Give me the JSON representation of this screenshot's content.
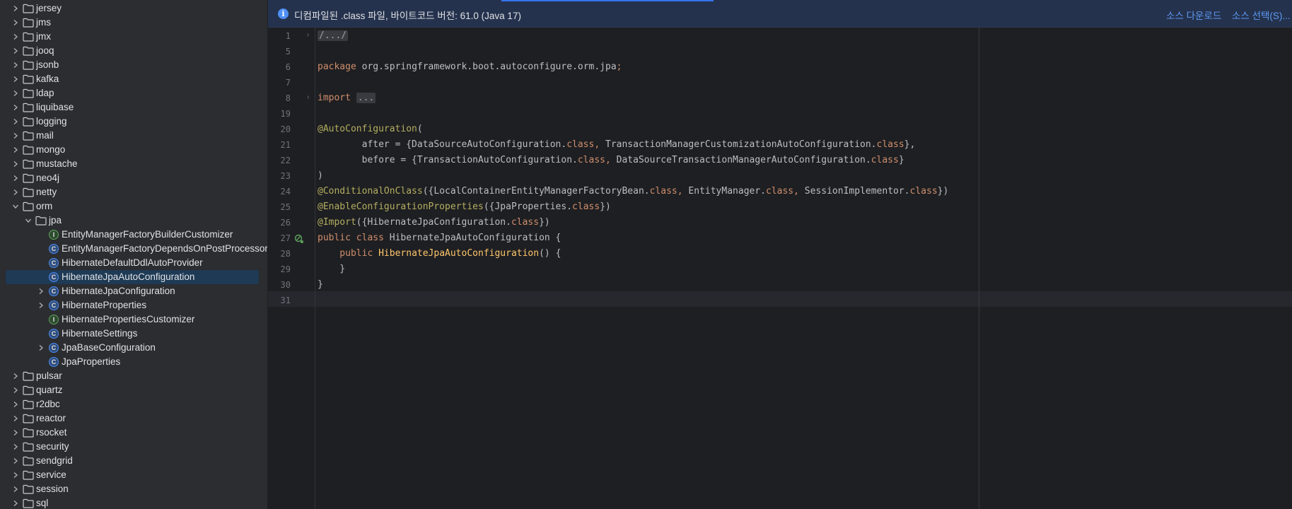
{
  "sidebar": {
    "items": [
      {
        "label": "jersey",
        "type": "folder",
        "expanded": false
      },
      {
        "label": "jms",
        "type": "folder",
        "expanded": false
      },
      {
        "label": "jmx",
        "type": "folder",
        "expanded": false
      },
      {
        "label": "jooq",
        "type": "folder",
        "expanded": false
      },
      {
        "label": "jsonb",
        "type": "folder",
        "expanded": false
      },
      {
        "label": "kafka",
        "type": "folder",
        "expanded": false
      },
      {
        "label": "ldap",
        "type": "folder",
        "expanded": false
      },
      {
        "label": "liquibase",
        "type": "folder",
        "expanded": false
      },
      {
        "label": "logging",
        "type": "folder",
        "expanded": false
      },
      {
        "label": "mail",
        "type": "folder",
        "expanded": false
      },
      {
        "label": "mongo",
        "type": "folder",
        "expanded": false
      },
      {
        "label": "mustache",
        "type": "folder",
        "expanded": false
      },
      {
        "label": "neo4j",
        "type": "folder",
        "expanded": false
      },
      {
        "label": "netty",
        "type": "folder",
        "expanded": false
      },
      {
        "label": "orm",
        "type": "folder",
        "expanded": true
      },
      {
        "label": "jpa",
        "type": "folder",
        "expanded": true
      },
      {
        "label": "EntityManagerFactoryBuilderCustomizer",
        "type": "interface"
      },
      {
        "label": "EntityManagerFactoryDependsOnPostProcessor",
        "type": "class"
      },
      {
        "label": "HibernateDefaultDdlAutoProvider",
        "type": "class"
      },
      {
        "label": "HibernateJpaAutoConfiguration",
        "type": "class",
        "selected": true
      },
      {
        "label": "HibernateJpaConfiguration",
        "type": "class",
        "expandable": true
      },
      {
        "label": "HibernateProperties",
        "type": "class",
        "expandable": true
      },
      {
        "label": "HibernatePropertiesCustomizer",
        "type": "interface"
      },
      {
        "label": "HibernateSettings",
        "type": "class"
      },
      {
        "label": "JpaBaseConfiguration",
        "type": "class",
        "expandable": true
      },
      {
        "label": "JpaProperties",
        "type": "class"
      },
      {
        "label": "pulsar",
        "type": "folder",
        "expanded": false
      },
      {
        "label": "quartz",
        "type": "folder",
        "expanded": false
      },
      {
        "label": "r2dbc",
        "type": "folder",
        "expanded": false
      },
      {
        "label": "reactor",
        "type": "folder",
        "expanded": false
      },
      {
        "label": "rsocket",
        "type": "folder",
        "expanded": false
      },
      {
        "label": "security",
        "type": "folder",
        "expanded": false
      },
      {
        "label": "sendgrid",
        "type": "folder",
        "expanded": false
      },
      {
        "label": "service",
        "type": "folder",
        "expanded": false
      },
      {
        "label": "session",
        "type": "folder",
        "expanded": false
      },
      {
        "label": "sql",
        "type": "folder",
        "expanded": false
      }
    ]
  },
  "banner": {
    "text": "디컴파일된 .class 파일, 바이트코드 버전: 61.0 (Java 17)",
    "download_link": "소스 다운로드",
    "choose_link": "소스 선택(S)..."
  },
  "editor": {
    "lines": [
      {
        "num": "1",
        "fold": true,
        "tokens": [
          {
            "t": "/.../",
            "c": "fold-box"
          }
        ]
      },
      {
        "num": "5",
        "tokens": []
      },
      {
        "num": "6",
        "tokens": [
          {
            "t": "package",
            "c": "kw"
          },
          {
            "t": " org.springframework.boot.autoconfigure.orm.jpa",
            "c": ""
          },
          {
            "t": ";",
            "c": "kw"
          }
        ]
      },
      {
        "num": "7",
        "tokens": []
      },
      {
        "num": "8",
        "fold": true,
        "tokens": [
          {
            "t": "import",
            "c": "kw"
          },
          {
            "t": " ",
            "c": ""
          },
          {
            "t": "...",
            "c": "fold-box"
          }
        ]
      },
      {
        "num": "19",
        "tokens": []
      },
      {
        "num": "20",
        "tokens": [
          {
            "t": "@AutoConfiguration",
            "c": "ann"
          },
          {
            "t": "(",
            "c": ""
          }
        ]
      },
      {
        "num": "21",
        "tokens": [
          {
            "t": "        after = {DataSourceAutoConfiguration.",
            "c": ""
          },
          {
            "t": "class",
            "c": "kw"
          },
          {
            "t": ", ",
            "c": "kw"
          },
          {
            "t": "TransactionManagerCustomizationAutoConfiguration.",
            "c": ""
          },
          {
            "t": "class",
            "c": "kw"
          },
          {
            "t": "},",
            "c": ""
          }
        ]
      },
      {
        "num": "22",
        "tokens": [
          {
            "t": "        before = {TransactionAutoConfiguration.",
            "c": ""
          },
          {
            "t": "class",
            "c": "kw"
          },
          {
            "t": ", ",
            "c": "kw"
          },
          {
            "t": "DataSourceTransactionManagerAutoConfiguration.",
            "c": ""
          },
          {
            "t": "class",
            "c": "kw"
          },
          {
            "t": "}",
            "c": ""
          }
        ]
      },
      {
        "num": "23",
        "tokens": [
          {
            "t": ")",
            "c": ""
          }
        ]
      },
      {
        "num": "24",
        "tokens": [
          {
            "t": "@ConditionalOnClass",
            "c": "ann"
          },
          {
            "t": "({LocalContainerEntityManagerFactoryBean.",
            "c": ""
          },
          {
            "t": "class",
            "c": "kw"
          },
          {
            "t": ", ",
            "c": "kw"
          },
          {
            "t": "EntityManager.",
            "c": ""
          },
          {
            "t": "class",
            "c": "kw"
          },
          {
            "t": ", ",
            "c": "kw"
          },
          {
            "t": "SessionImplementor.",
            "c": ""
          },
          {
            "t": "class",
            "c": "kw"
          },
          {
            "t": "})",
            "c": ""
          }
        ]
      },
      {
        "num": "25",
        "tokens": [
          {
            "t": "@EnableConfigurationProperties",
            "c": "ann"
          },
          {
            "t": "({JpaProperties.",
            "c": ""
          },
          {
            "t": "class",
            "c": "kw"
          },
          {
            "t": "})",
            "c": ""
          }
        ]
      },
      {
        "num": "26",
        "tokens": [
          {
            "t": "@Import",
            "c": "ann"
          },
          {
            "t": "({HibernateJpaConfiguration.",
            "c": ""
          },
          {
            "t": "class",
            "c": "kw"
          },
          {
            "t": "})",
            "c": ""
          }
        ]
      },
      {
        "num": "27",
        "tokens": [
          {
            "t": "public class",
            "c": "kw"
          },
          {
            "t": " HibernateJpaAutoConfiguration {",
            "c": ""
          }
        ]
      },
      {
        "num": "28",
        "tokens": [
          {
            "t": "    public",
            "c": "kw"
          },
          {
            "t": " ",
            "c": ""
          },
          {
            "t": "HibernateJpaAutoConfiguration",
            "c": "decl"
          },
          {
            "t": "() {",
            "c": ""
          }
        ]
      },
      {
        "num": "29",
        "tokens": [
          {
            "t": "    }",
            "c": ""
          }
        ]
      },
      {
        "num": "30",
        "tokens": [
          {
            "t": "}",
            "c": ""
          }
        ]
      },
      {
        "num": "31",
        "tokens": []
      }
    ]
  },
  "colors": {
    "accent": "#3574f0",
    "selection": "#1e3a55",
    "keyword": "#cf8e6d",
    "annotation": "#b3ae60"
  }
}
